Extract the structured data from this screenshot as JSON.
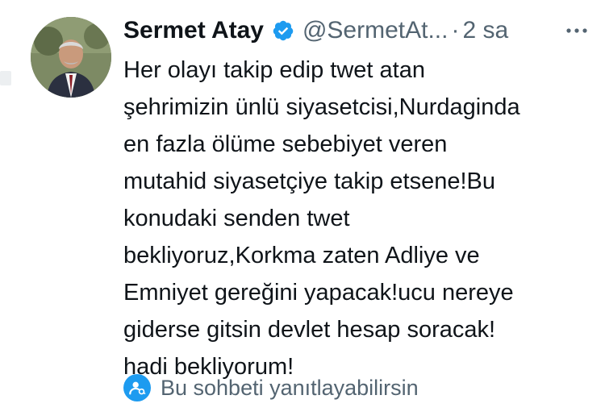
{
  "tweet": {
    "author": {
      "display_name": "Sermet Atay",
      "handle": "@SermetAt...",
      "verified": true,
      "avatar_icon": "profile-photo"
    },
    "separator": "·",
    "time": "2 sa",
    "more_icon": "more-horizontal-icon",
    "text": "Her olayı takip edip twet atan\nşehrimizin ünlü siyasetcisi,Nurdaginda\nen fazla ölüme sebebiyet veren\nmutahid siyasetçiye takip etsene!Bu\nkonudaki senden twet\nbekliyoruz,Korkma zaten Adliye ve\nEmniyet gereğini yapacak!ucu nereye\ngiderse gitsin devlet hesap soracak!\nhadi bekliyorum!",
    "reply_notice": {
      "icon": "person-at-icon",
      "label": "Bu sohbeti yanıtlayabilirsin"
    }
  },
  "colors": {
    "primary_text": "#0f1419",
    "secondary_text": "#536471",
    "accent": "#1d9bf0"
  }
}
